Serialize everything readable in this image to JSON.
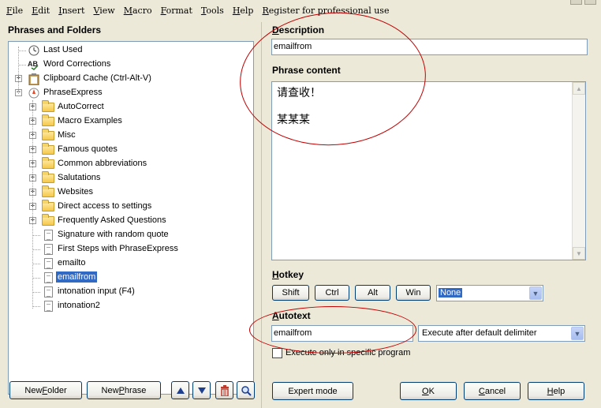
{
  "menu": {
    "items": [
      {
        "u": "F",
        "rest": "ile"
      },
      {
        "u": "E",
        "rest": "dit"
      },
      {
        "u": "I",
        "rest": "nsert"
      },
      {
        "u": "V",
        "rest": "iew"
      },
      {
        "u": "M",
        "rest": "acro"
      },
      {
        "u": "F",
        "rest": "ormat"
      },
      {
        "u": "T",
        "rest": "ools"
      },
      {
        "u": "H",
        "rest": "elp"
      },
      {
        "u": "R",
        "rest": "egister for professional use"
      }
    ]
  },
  "left": {
    "title": "Phrases and Folders",
    "tree": [
      {
        "label": "Last Used",
        "icon": "clock-icon",
        "level": 0,
        "expander": false
      },
      {
        "label": "Word Corrections",
        "icon": "spellcheck-icon",
        "level": 0,
        "expander": false
      },
      {
        "label": "Clipboard Cache (Ctrl-Alt-V)",
        "icon": "clipboard-icon",
        "level": 0,
        "expander": true
      },
      {
        "label": "PhraseExpress",
        "icon": "phraseexpress-icon",
        "level": 0,
        "expander": true,
        "expanded": true
      },
      {
        "label": "AutoCorrect",
        "icon": "folder-icon",
        "level": 1,
        "expander": true
      },
      {
        "label": "Macro Examples",
        "icon": "folder-icon",
        "level": 1,
        "expander": true
      },
      {
        "label": "Misc",
        "icon": "folder-icon",
        "level": 1,
        "expander": true
      },
      {
        "label": "Famous quotes",
        "icon": "folder-icon",
        "level": 1,
        "expander": true
      },
      {
        "label": "Common abbreviations",
        "icon": "folder-icon",
        "level": 1,
        "expander": true
      },
      {
        "label": "Salutations",
        "icon": "folder-icon",
        "level": 1,
        "expander": true
      },
      {
        "label": "Websites",
        "icon": "folder-icon",
        "level": 1,
        "expander": true
      },
      {
        "label": "Direct access to settings",
        "icon": "folder-icon",
        "level": 1,
        "expander": true
      },
      {
        "label": "Frequently Asked Questions",
        "icon": "folder-icon",
        "level": 1,
        "expander": true
      },
      {
        "label": "Signature with random quote",
        "icon": "document-icon",
        "level": 1,
        "expander": false
      },
      {
        "label": "First Steps with PhraseExpress",
        "icon": "document-icon",
        "level": 1,
        "expander": false
      },
      {
        "label": "emailto",
        "icon": "document-icon",
        "level": 1,
        "expander": false
      },
      {
        "label": "emailfrom",
        "icon": "document-icon",
        "level": 1,
        "expander": false,
        "selected": true
      },
      {
        "label": "intonation input (F4)",
        "icon": "document-icon",
        "level": 1,
        "expander": false
      },
      {
        "label": "intonation2",
        "icon": "document-icon",
        "level": 1,
        "expander": false
      }
    ],
    "buttons": {
      "new_folder_pre": "New ",
      "new_folder_u": "F",
      "new_folder_post": "older",
      "new_phrase_pre": "New ",
      "new_phrase_u": "P",
      "new_phrase_post": "hrase"
    }
  },
  "right": {
    "description_label_u": "D",
    "description_label_rest": "escription",
    "description_value": "emailfrom",
    "phrase_content_label": "Phrase content",
    "phrase_content_lines": [
      "请查收！",
      "某某某"
    ],
    "hotkey_label_u": "H",
    "hotkey_label_rest": "otkey",
    "hotkey_buttons": [
      "Shift",
      "Ctrl",
      "Alt",
      "Win"
    ],
    "hotkey_key": "None",
    "autotext_label_u": "A",
    "autotext_label_rest": "utotext",
    "autotext_value": "emailfrom",
    "autotext_mode": "Execute after default delimiter",
    "specific_program_label": "Execute only in specific program",
    "specific_program_checked": false,
    "expert_mode": "Expert mode",
    "ok_u": "O",
    "ok_rest": "K",
    "cancel_u": "C",
    "cancel_rest": "ancel",
    "help_u": "H",
    "help_rest": "elp"
  },
  "colors": {
    "annotation": "#c00000",
    "selection": "#316ac5"
  }
}
